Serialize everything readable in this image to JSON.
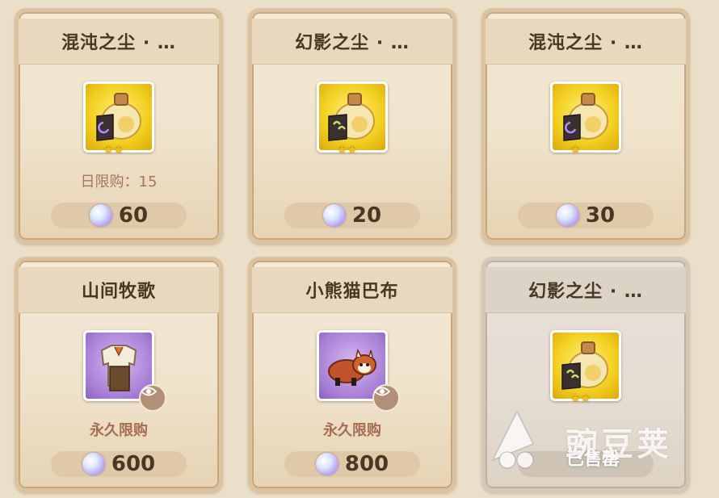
{
  "items": [
    {
      "name": "混沌之尘 · …",
      "type": "dust-chaos",
      "stars": "★★",
      "limit": "日限购：15",
      "price": "60",
      "sold_out": false
    },
    {
      "name": "幻影之尘 · …",
      "type": "dust-phantom",
      "stars": "★★",
      "limit": "",
      "price": "20",
      "sold_out": false
    },
    {
      "name": "混沌之尘 · …",
      "type": "dust-chaos",
      "stars": "★",
      "limit": "",
      "price": "30",
      "sold_out": false
    },
    {
      "name": "山间牧歌",
      "type": "outfit",
      "stars": "",
      "limit": "永久限购",
      "price": "600",
      "sold_out": false
    },
    {
      "name": "小熊猫巴布",
      "type": "red-panda",
      "stars": "",
      "limit": "永久限购",
      "price": "800",
      "sold_out": false
    },
    {
      "name": "幻影之尘 · …",
      "type": "dust-phantom",
      "stars": "★★",
      "limit": "",
      "price": "",
      "sold_out": true,
      "sold_label": "已售罄"
    }
  ],
  "watermark": {
    "text": "豌豆荚"
  },
  "colors": {
    "gold_frame": "#f2cf20",
    "purple_frame": "#a77fd6",
    "price_text": "#4a3624",
    "limit_text": "#a76d52"
  }
}
